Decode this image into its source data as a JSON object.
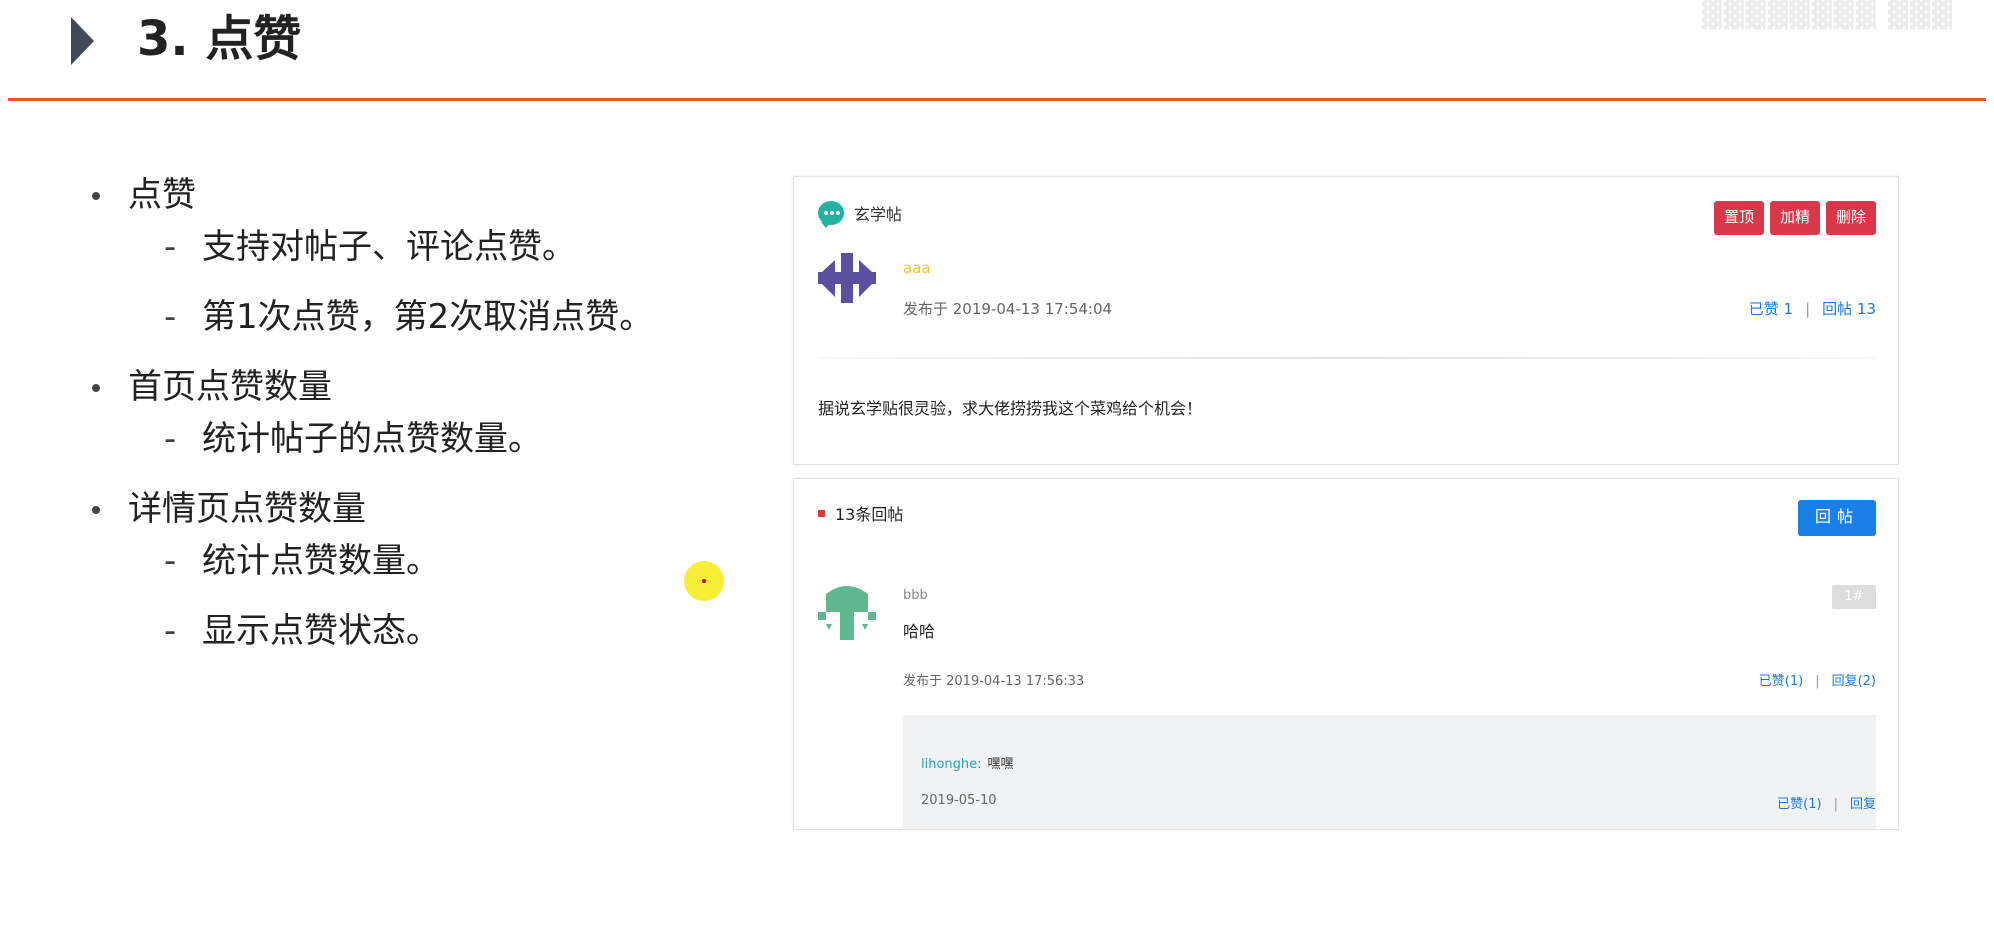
{
  "slide": {
    "title": "3. 点赞",
    "watermark": "▓▓▓▓▓▓▓▓ ▓▓▓"
  },
  "bullets": [
    {
      "label": "点赞",
      "subs": [
        "支持对帖子、评论点赞。",
        "第1次点赞，第2次取消点赞。"
      ]
    },
    {
      "label": "首页点赞数量",
      "subs": [
        "统计帖子的点赞数量。"
      ]
    },
    {
      "label": "详情页点赞数量",
      "subs": [
        "统计点赞数量。",
        "显示点赞状态。"
      ]
    }
  ],
  "post": {
    "title": "玄学帖",
    "buttons": {
      "pin": "置顶",
      "highlight": "加精",
      "delete": "删除"
    },
    "author": "aaa",
    "date": "发布于 2019-04-13 17:54:04",
    "likes": "已赞 1",
    "replies": "回帖 13",
    "separator": "|",
    "body": "据说玄学贴很灵验，求大佬捞捞我这个菜鸡给个机会！"
  },
  "replies_section": {
    "count_label": "13条回帖",
    "reply_button": "回帖",
    "comment": {
      "author": "bbb",
      "floor": "1#",
      "text": "哈哈",
      "date": "发布于 2019-04-13 17:56:33",
      "likes": "已赞(1)",
      "reply_count": "回复(2)",
      "separator": "|"
    },
    "sub_reply": {
      "author": "lihonghe:",
      "text": "嘿嘿",
      "date": "2019-05-10",
      "likes": "已赞(1)",
      "reply": "回复",
      "separator": "|"
    }
  },
  "colors": {
    "accent_rule": "#e8582b",
    "danger": "#d9384a",
    "primary": "#1b7fe8",
    "link": "#1b7ae0"
  }
}
